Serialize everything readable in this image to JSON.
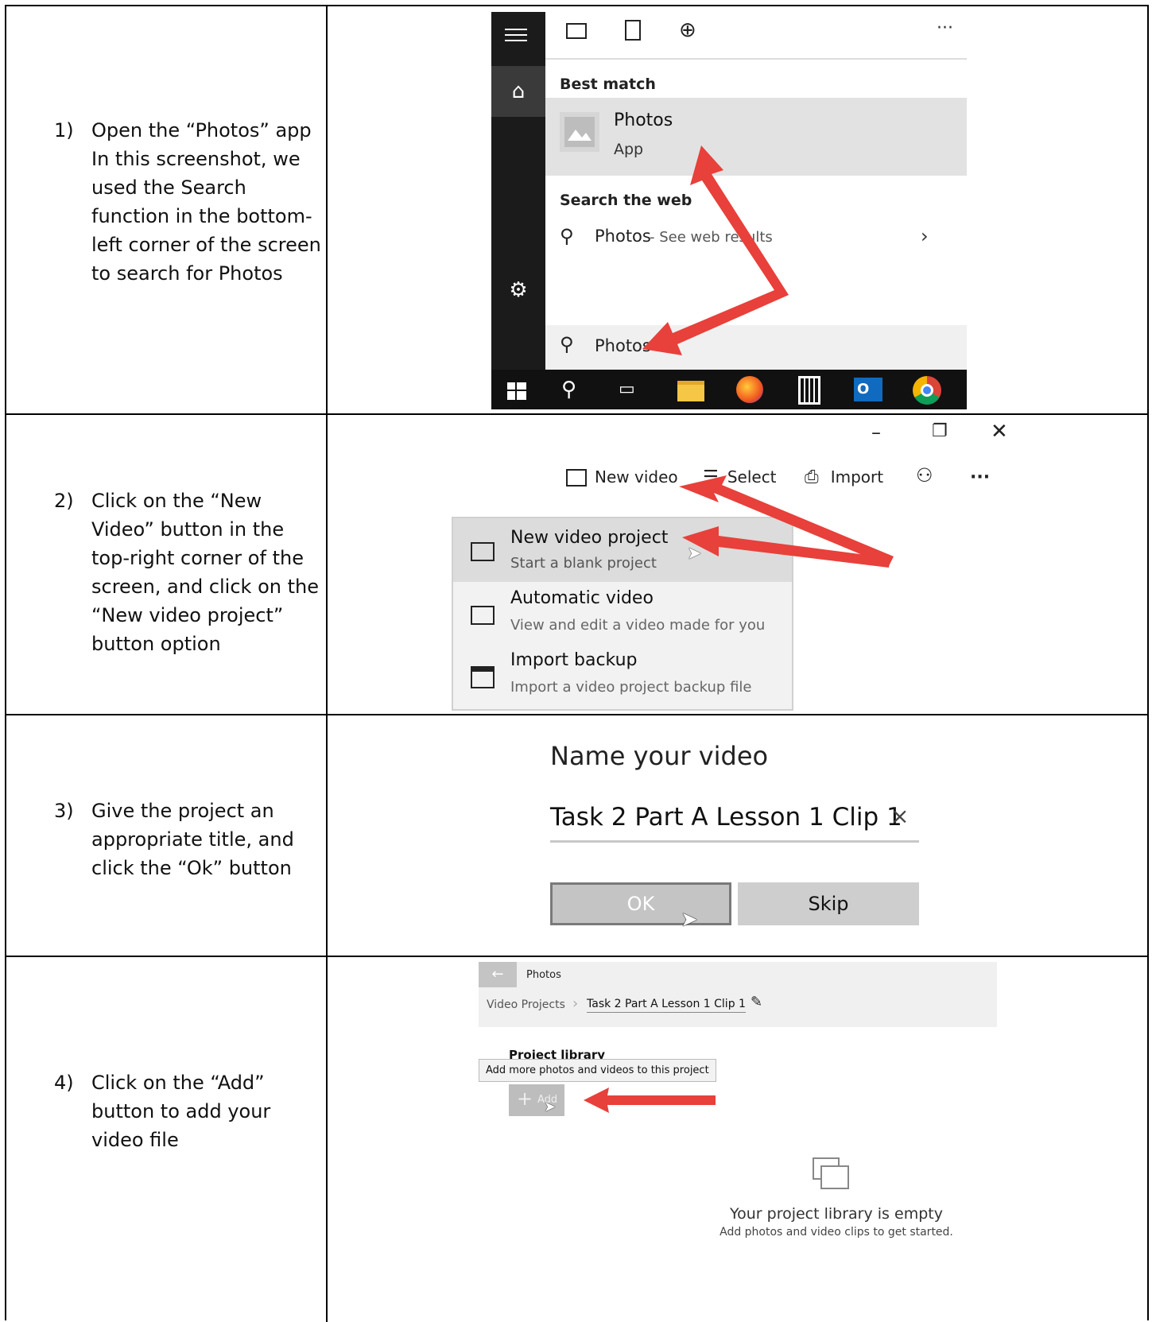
{
  "steps": [
    {
      "number": "1)",
      "text": "Open the “Photos” app In this screenshot, we used the Search function in the bottom-left corner of the screen to search for Photos"
    },
    {
      "number": "2)",
      "text": "Click on the “New Video” button in the top-right corner of the screen, and click on the “New video project” button option"
    },
    {
      "number": "3)",
      "text": "Give the project an appropriate title, and click the “Ok” button"
    },
    {
      "number": "4)",
      "text": "Click on the “Add” button to add your video file"
    }
  ],
  "search_panel": {
    "more": "···",
    "best_match": "Best match",
    "app_name": "Photos",
    "app_type": "App",
    "search_web": "Search the web",
    "web_query": "Photos",
    "web_suffix": " - See web results",
    "query": "Photos"
  },
  "video_menu": {
    "toolbar": {
      "new_video": "New video",
      "select": "Select",
      "import": "Import",
      "more": "···"
    },
    "items": [
      {
        "title": "New video project",
        "subtitle": "Start a blank project"
      },
      {
        "title": "Automatic video",
        "subtitle": "View and edit a video made for you"
      },
      {
        "title": "Import backup",
        "subtitle": "Import a video project backup file"
      }
    ]
  },
  "name_dialog": {
    "title": "Name your video",
    "value": "Task 2 Part A Lesson 1 Clip 1",
    "clear": "×",
    "ok": "OK",
    "skip": "Skip"
  },
  "project": {
    "app": "Photos",
    "back": "←",
    "crumb_root": "Video Projects",
    "crumb_current": "Task 2 Part A Lesson 1 Clip 1",
    "library": "Project library",
    "tooltip": "Add more photos and videos to this project",
    "add": "Add",
    "empty_title": "Your project library is empty",
    "empty_sub": "Add photos and video clips to get started."
  },
  "colors": {
    "arrow": "#e8403a",
    "start_bg": "#1b1b1b",
    "highlight": "#e2e2e2"
  }
}
